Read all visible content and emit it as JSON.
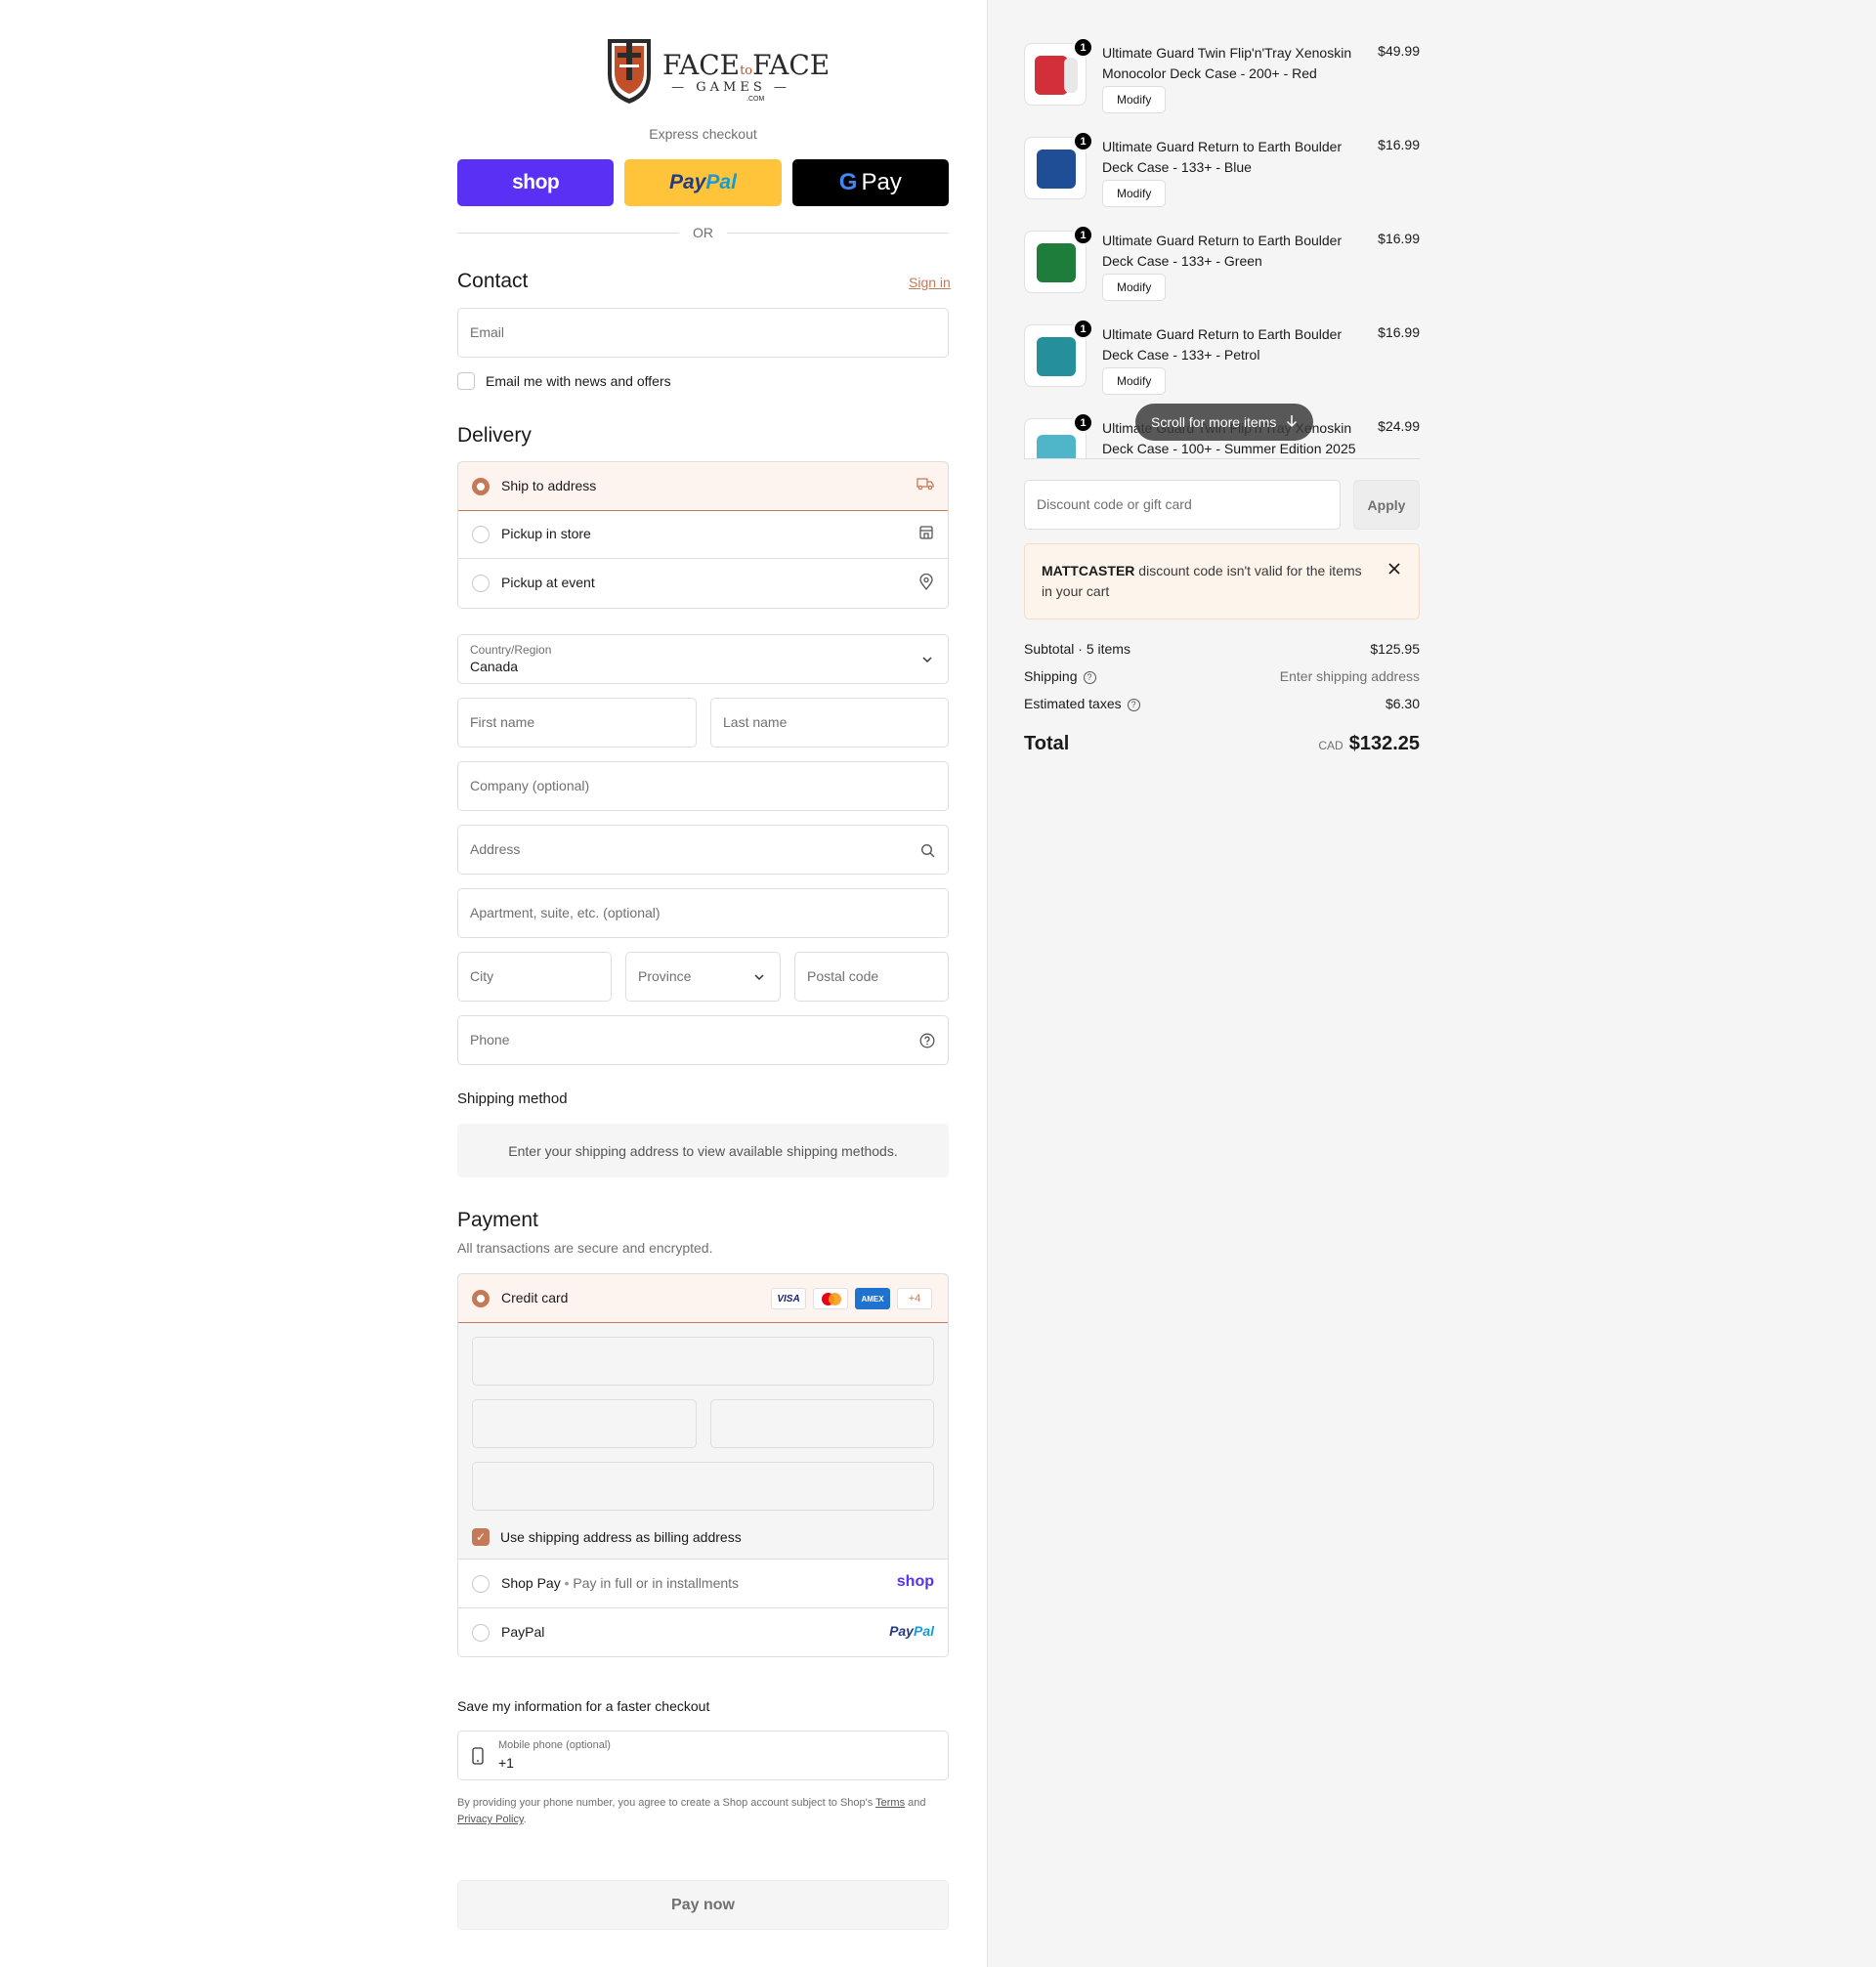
{
  "brand": {
    "name_left": "FACE",
    "name_to": "to",
    "name_right": "FACE",
    "sub": "GAMES",
    "com": ".COM"
  },
  "express": {
    "label": "Express checkout",
    "shop": "shop",
    "paypal_a": "Pay",
    "paypal_b": "Pal",
    "gpay_g": "G",
    "gpay": "Pay",
    "or": "OR"
  },
  "contact": {
    "title": "Contact",
    "sign_in": "Sign in",
    "email_placeholder": "Email",
    "news_label": "Email me with news and offers"
  },
  "delivery": {
    "title": "Delivery",
    "options": [
      {
        "label": "Ship to address",
        "icon": "truck-icon",
        "selected": true
      },
      {
        "label": "Pickup in store",
        "icon": "store-icon",
        "selected": false
      },
      {
        "label": "Pickup at event",
        "icon": "location-pin-icon",
        "selected": false
      }
    ],
    "country_label": "Country/Region",
    "country_value": "Canada",
    "first_name": "First name",
    "last_name": "Last name",
    "company": "Company (optional)",
    "address": "Address",
    "apartment": "Apartment, suite, etc. (optional)",
    "city": "City",
    "province": "Province",
    "postal": "Postal code",
    "phone": "Phone"
  },
  "shipping_method": {
    "title": "Shipping method",
    "info": "Enter your shipping address to view available shipping methods."
  },
  "payment": {
    "title": "Payment",
    "subtitle": "All transactions are secure and encrypted.",
    "credit_card": "Credit card",
    "card_brands": [
      "VISA",
      "AMEX",
      "+4"
    ],
    "billing_same": "Use shipping address as billing address",
    "shop_pay": "Shop Pay",
    "shop_pay_sub": "Pay in full or in installments",
    "shop_logo": "shop",
    "paypal": "PayPal",
    "paypal_logo_a": "Pay",
    "paypal_logo_b": "Pal"
  },
  "save_info": {
    "title": "Save my information for a faster checkout",
    "phone_label": "Mobile phone (optional)",
    "phone_value": "+1",
    "legal_a": "By providing your phone number, you agree to create a Shop account subject to Shop's",
    "terms": "Terms",
    "legal_and": "and",
    "privacy": "Privacy Policy",
    "legal_end": "."
  },
  "pay_now": "Pay now",
  "cart": {
    "items": [
      {
        "name": "Ultimate Guard Twin Flip'n'Tray Xenoskin Monocolor Deck Case - 200+ - Red",
        "price": "$49.99",
        "qty": "1",
        "color": "#d32f3a"
      },
      {
        "name": "Ultimate Guard Return to Earth Boulder Deck Case - 133+ - Blue",
        "price": "$16.99",
        "qty": "1",
        "color": "#1f4e96"
      },
      {
        "name": "Ultimate Guard Return to Earth Boulder Deck Case - 133+ - Green",
        "price": "$16.99",
        "qty": "1",
        "color": "#1e7d3a"
      },
      {
        "name": "Ultimate Guard Return to Earth Boulder Deck Case - 133+ - Petrol",
        "price": "$16.99",
        "qty": "1",
        "color": "#258f9c"
      },
      {
        "name": "Ultimate Guard Twin Flip'n'Tray Xenoskin Deck Case - 100+ - Summer Edition 2025 -",
        "price": "$24.99",
        "qty": "1",
        "color": "#4fb6c9"
      }
    ],
    "modify": "Modify",
    "scroll_hint": "Scroll for more items",
    "discount_placeholder": "Discount code or gift card",
    "apply": "Apply",
    "warning_code": "MATTCASTER",
    "warning_text": " discount code isn't valid for the items in your cart",
    "subtotal_label": "Subtotal · 5 items",
    "subtotal": "$125.95",
    "shipping_label": "Shipping",
    "shipping_value": "Enter shipping address",
    "taxes_label": "Estimated taxes",
    "taxes_value": "$6.30",
    "total_label": "Total",
    "currency": "CAD",
    "total": "$132.25"
  },
  "colors": {
    "accent": "#c47a58",
    "shop_purple": "#5a31f4",
    "paypal_yellow": "#ffc439"
  }
}
